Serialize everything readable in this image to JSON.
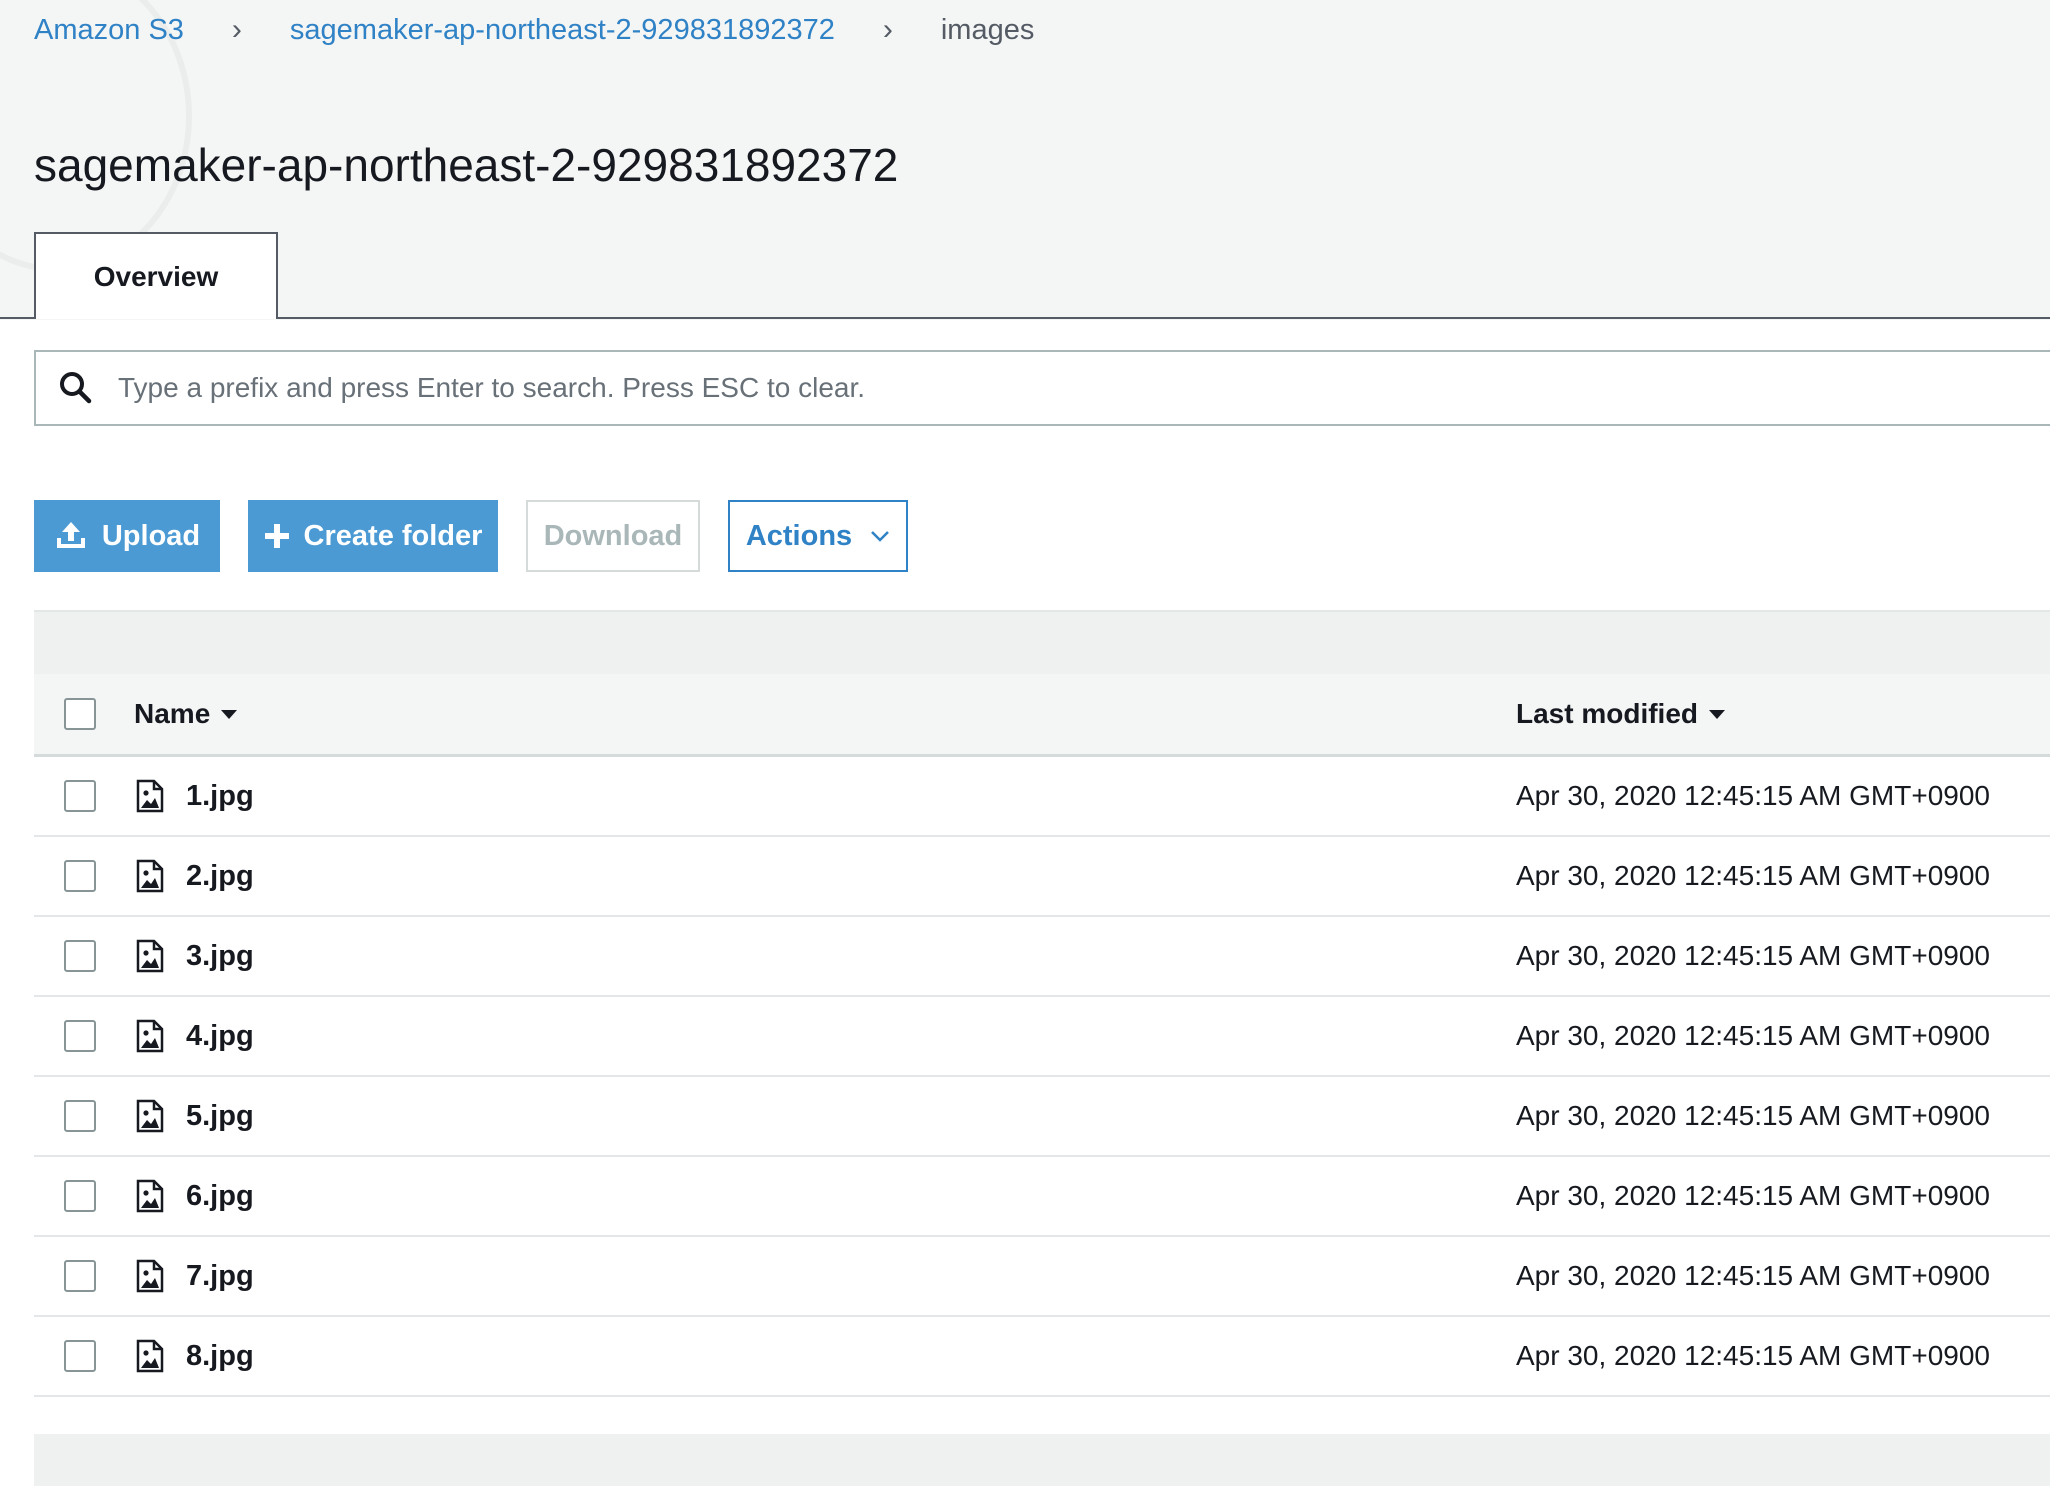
{
  "breadcrumb": {
    "items": [
      "Amazon S3",
      "sagemaker-ap-northeast-2-929831892372",
      "images"
    ],
    "separator": "›"
  },
  "page_title": "sagemaker-ap-northeast-2-929831892372",
  "tabs": [
    {
      "label": "Overview",
      "active": true
    }
  ],
  "search": {
    "placeholder": "Type a prefix and press Enter to search. Press ESC to clear.",
    "value": ""
  },
  "toolbar": {
    "upload_label": "Upload",
    "create_folder_label": "Create folder",
    "download_label": "Download",
    "actions_label": "Actions"
  },
  "table": {
    "columns": [
      "Name",
      "Last modified"
    ],
    "rows": [
      {
        "name": "1.jpg",
        "last_modified": "Apr 30, 2020 12:45:15 AM GMT+0900"
      },
      {
        "name": "2.jpg",
        "last_modified": "Apr 30, 2020 12:45:15 AM GMT+0900"
      },
      {
        "name": "3.jpg",
        "last_modified": "Apr 30, 2020 12:45:15 AM GMT+0900"
      },
      {
        "name": "4.jpg",
        "last_modified": "Apr 30, 2020 12:45:15 AM GMT+0900"
      },
      {
        "name": "5.jpg",
        "last_modified": "Apr 30, 2020 12:45:15 AM GMT+0900"
      },
      {
        "name": "6.jpg",
        "last_modified": "Apr 30, 2020 12:45:15 AM GMT+0900"
      },
      {
        "name": "7.jpg",
        "last_modified": "Apr 30, 2020 12:45:15 AM GMT+0900"
      },
      {
        "name": "8.jpg",
        "last_modified": "Apr 30, 2020 12:45:15 AM GMT+0900"
      }
    ]
  },
  "icons": {
    "search": "search-icon",
    "upload": "upload-icon",
    "create_folder": "plus-icon",
    "actions": "chevron-down-icon",
    "sort": "caret-down-icon",
    "file": "image-file-icon"
  },
  "colors": {
    "link": "#2f82c5",
    "primary_button": "#4b9ad4",
    "text": "#16191f",
    "page_background": "#f4f5f5"
  }
}
